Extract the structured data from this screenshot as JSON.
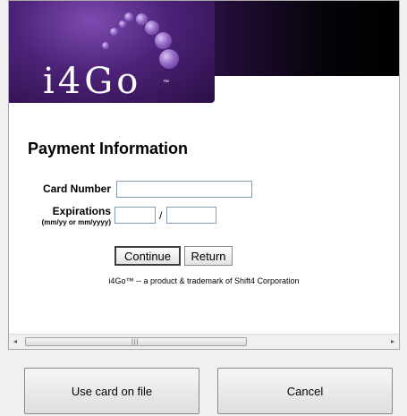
{
  "banner": {
    "logo_text": "i4Go",
    "logo_tm": "™"
  },
  "form": {
    "title": "Payment Information",
    "card_number_label": "Card Number",
    "card_number_value": "",
    "expirations_label": "Expirations",
    "expirations_hint": "(mm/yy or mm/yyyy)",
    "exp_month_value": "",
    "exp_year_value": "",
    "separator": "/",
    "continue_label": "Continue",
    "return_label": "Return"
  },
  "footer": {
    "text": "i4Go™ -- a product & trademark of Shift4 Corporation"
  },
  "scrollbar": {
    "left_arrow": "◂",
    "right_arrow": "▸",
    "grip": "|||"
  },
  "dialog": {
    "use_card_label": "Use card on file",
    "cancel_label": "Cancel"
  },
  "colors": {
    "brand_purple": "#5a2a86",
    "banner_black": "#000000"
  }
}
